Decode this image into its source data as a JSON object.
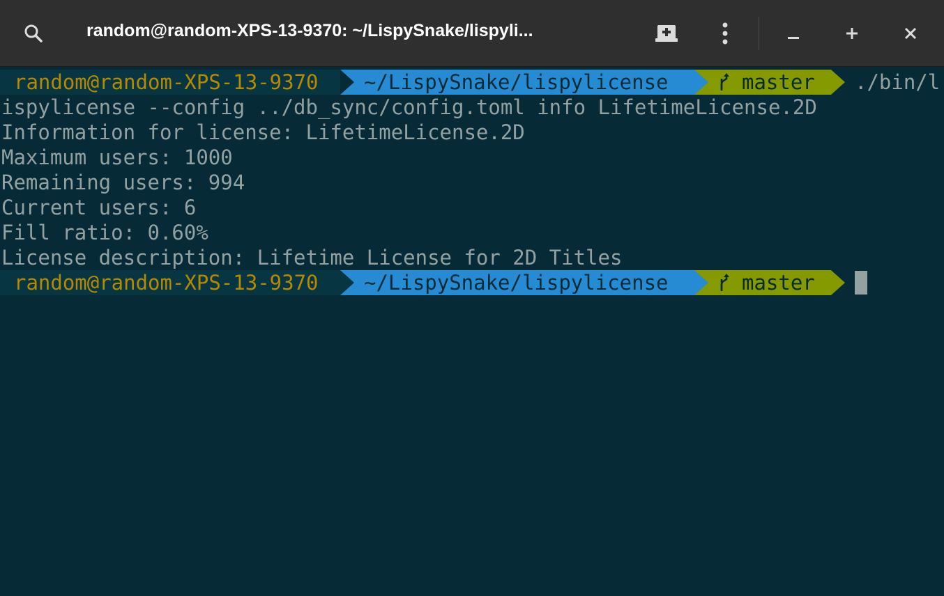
{
  "window": {
    "title": "random@random-XPS-13-9370: ~/LispySnake/lispyli...",
    "buttons": {
      "search_icon": "search-icon",
      "new_tab_icon": "new-tab-icon",
      "menu_icon": "kebab-menu-icon",
      "minimize_icon": "minimize-icon",
      "maximize_icon": "maximize-icon",
      "close_icon": "close-icon"
    }
  },
  "colors": {
    "titlebar": "#2f2f2f",
    "terminal_bg": "#062b36",
    "text": "#93a1a1",
    "host_fg": "#b58900",
    "host_bg": "#073642",
    "path_bg": "#268bd2",
    "git_bg": "#859900"
  },
  "terminal": {
    "prompt1": {
      "host": "random@random-XPS-13-9370",
      "path": "~/LispySnake/lispylicense",
      "branch_icon": "git-branch-icon",
      "branch": "master",
      "command_start": "./bin/l"
    },
    "output_lines": [
      "ispylicense --config ../db_sync/config.toml info LifetimeLicense.2D",
      "Information for license: LifetimeLicense.2D",
      "Maximum users: 1000",
      "Remaining users: 994",
      "Current users: 6",
      "Fill ratio: 0.60%",
      "License description: Lifetime License for 2D Titles"
    ],
    "prompt2": {
      "host": "random@random-XPS-13-9370",
      "path": "~/LispySnake/lispylicense",
      "branch_icon": "git-branch-icon",
      "branch": "master"
    }
  }
}
